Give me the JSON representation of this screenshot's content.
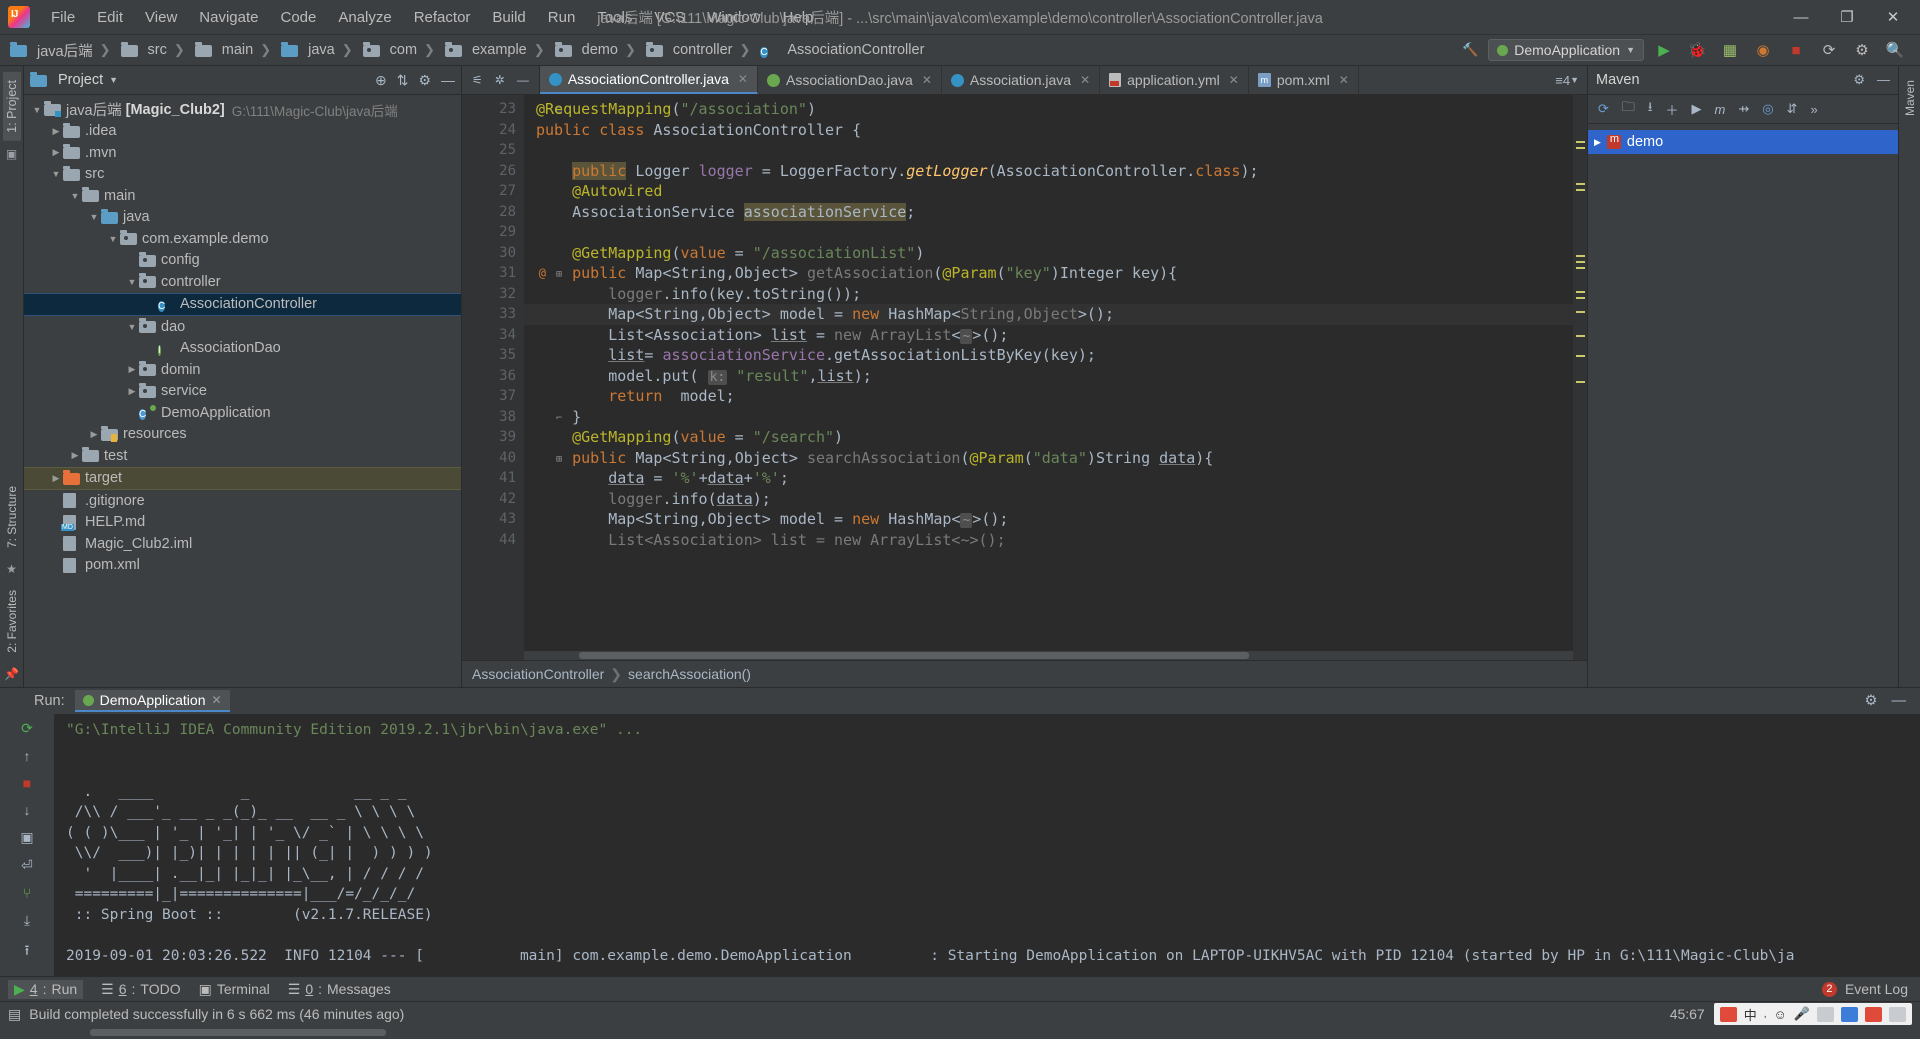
{
  "window": {
    "title": "java后端 [G:\\111\\Magic-Club\\java后端] - ...\\src\\main\\java\\com\\example\\demo\\controller\\AssociationController.java",
    "minimize": "—",
    "maximize": "❐",
    "close": "✕"
  },
  "menu": [
    "File",
    "Edit",
    "View",
    "Navigate",
    "Code",
    "Analyze",
    "Refactor",
    "Build",
    "Run",
    "Tools",
    "VCS",
    "Window",
    "Help"
  ],
  "breadcrumb": [
    "java后端",
    "src",
    "main",
    "java",
    "com",
    "example",
    "demo",
    "controller",
    "AssociationController"
  ],
  "navbar_right": {
    "run_config": "DemoApplication",
    "icons": [
      "hammer-icon",
      "run-icon",
      "debug-icon",
      "coverage-icon",
      "profile-icon",
      "stop-icon",
      "update-icon",
      "settings-icon",
      "search-icon"
    ]
  },
  "project_panel": {
    "title": "Project",
    "left_tabs": [
      "1: Project"
    ],
    "tree": [
      {
        "depth": 0,
        "arrow": "▼",
        "icon": "module-folder",
        "label": "java后端",
        "bold_label": "[Magic_Club2]",
        "path": "G:\\111\\Magic-Club\\java后端",
        "state": "normal"
      },
      {
        "depth": 1,
        "arrow": "▶",
        "icon": "folder",
        "label": ".idea",
        "state": "normal"
      },
      {
        "depth": 1,
        "arrow": "▶",
        "icon": "folder",
        "label": ".mvn",
        "state": "normal"
      },
      {
        "depth": 1,
        "arrow": "▼",
        "icon": "folder",
        "label": "src",
        "state": "normal"
      },
      {
        "depth": 2,
        "arrow": "▼",
        "icon": "folder",
        "label": "main",
        "state": "normal"
      },
      {
        "depth": 3,
        "arrow": "▼",
        "icon": "folder-blue",
        "label": "java",
        "state": "normal"
      },
      {
        "depth": 4,
        "arrow": "▼",
        "icon": "package",
        "label": "com.example.demo",
        "state": "normal"
      },
      {
        "depth": 5,
        "arrow": "",
        "icon": "package",
        "label": "config",
        "state": "normal"
      },
      {
        "depth": 5,
        "arrow": "▼",
        "icon": "package",
        "label": "controller",
        "state": "normal"
      },
      {
        "depth": 6,
        "arrow": "",
        "icon": "class",
        "label": "AssociationController",
        "state": "selected"
      },
      {
        "depth": 5,
        "arrow": "▼",
        "icon": "package",
        "label": "dao",
        "state": "normal"
      },
      {
        "depth": 6,
        "arrow": "",
        "icon": "interface",
        "label": "AssociationDao",
        "state": "normal"
      },
      {
        "depth": 5,
        "arrow": "▶",
        "icon": "package",
        "label": "domin",
        "state": "normal"
      },
      {
        "depth": 5,
        "arrow": "▶",
        "icon": "package",
        "label": "service",
        "state": "normal"
      },
      {
        "depth": 5,
        "arrow": "",
        "icon": "spring-class",
        "label": "DemoApplication",
        "state": "normal"
      },
      {
        "depth": 3,
        "arrow": "▶",
        "icon": "resources-folder",
        "label": "resources",
        "state": "normal"
      },
      {
        "depth": 2,
        "arrow": "▶",
        "icon": "folder",
        "label": "test",
        "state": "normal"
      },
      {
        "depth": 1,
        "arrow": "▶",
        "icon": "folder-orange",
        "label": "target",
        "state": "highlight"
      },
      {
        "depth": 1,
        "arrow": "",
        "icon": "file",
        "label": ".gitignore",
        "state": "normal"
      },
      {
        "depth": 1,
        "arrow": "",
        "icon": "file-md",
        "label": "HELP.md",
        "state": "normal"
      },
      {
        "depth": 1,
        "arrow": "",
        "icon": "file",
        "label": "Magic_Club2.iml",
        "state": "normal"
      },
      {
        "depth": 1,
        "arrow": "",
        "icon": "file",
        "label": "pom.xml",
        "state": "normal"
      }
    ]
  },
  "editor": {
    "tabs": [
      {
        "label": "AssociationController.java",
        "icon": "class-icon",
        "active": true
      },
      {
        "label": "AssociationDao.java",
        "icon": "interface-icon",
        "active": false
      },
      {
        "label": "Association.java",
        "icon": "class-icon",
        "active": false
      },
      {
        "label": "application.yml",
        "icon": "yaml-icon",
        "active": false
      },
      {
        "label": "pom.xml",
        "icon": "maven-icon",
        "active": false
      }
    ],
    "tab_overflow": "4",
    "first_line_number": 23,
    "lines": [
      {
        "n": 23,
        "html": "<span class=\"ann\">@RequestMapping</span>(<span class=\"str\">\"/association\"</span>)",
        "indent": 0,
        "fold": "minus"
      },
      {
        "n": 24,
        "html": "<span class=\"kw\">public class</span> <span class=\"typ\">AssociationController</span> {",
        "indent": 0
      },
      {
        "n": 25,
        "html": "",
        "indent": 0
      },
      {
        "n": 26,
        "html": "    <span class=\"kw hl\">public</span> <span class=\"typ\">Logger</span> <span class=\"fld\">logger</span> = <span class=\"typ\">LoggerFactory</span>.<span class=\"ital\">getLogger</span>(<span class=\"typ\">AssociationController</span>.<span class=\"kw\">class</span>);",
        "indent": 1
      },
      {
        "n": 27,
        "html": "    <span class=\"ann\">@Autowired</span>",
        "indent": 1
      },
      {
        "n": 28,
        "html": "    <span class=\"typ\">AssociationService</span> <span class=\"hl\">associationService</span>;",
        "indent": 1
      },
      {
        "n": 29,
        "html": "",
        "indent": 1
      },
      {
        "n": 30,
        "html": "    <span class=\"ann\">@GetMapping</span>(<span class=\"kw\">value</span> = <span class=\"str\">\"/associationList\"</span>)",
        "indent": 1
      },
      {
        "n": 31,
        "html": "    <span class=\"kw\">public</span> <span class=\"typ\">Map</span>&lt;<span class=\"typ\">String</span>,<span class=\"typ\">Object</span>&gt; <span class=\"dimtype\">getAssociation</span>(<span class=\"ann\">@Param</span>(<span class=\"str\">\"key\"</span>)<span class=\"typ\">Integer</span> key){",
        "indent": 1,
        "gutter_mark": "@",
        "fold": "plus"
      },
      {
        "n": 32,
        "html": "        <span class=\"dimtype\">logger</span>.info(key.toString());",
        "indent": 2
      },
      {
        "n": 33,
        "html": "        <span class=\"typ\">Map</span>&lt;<span class=\"typ\">String</span>,<span class=\"typ\">Object</span>&gt; model = <span class=\"kw\">new</span> <span class=\"typ\">HashMap</span>&lt;<span class=\"dimtype\">String,Object</span>&gt;();",
        "indent": 2,
        "current": true
      },
      {
        "n": 34,
        "html": "        <span class=\"typ\">List</span>&lt;<span class=\"typ\">Association</span>&gt; <span class=\"undl\">list</span> = <span class=\"dimtype\">new ArrayList</span>&lt;<span class=\"hintk\">~</span>&gt;();",
        "indent": 2
      },
      {
        "n": 35,
        "html": "        <span class=\"undl\">list</span>= <span class=\"fld\">associationService</span>.getAssociationListByKey(key);",
        "indent": 2
      },
      {
        "n": 36,
        "html": "        model.put( <span class=\"hintk\">k:</span> <span class=\"str\">\"result\"</span>,<span class=\"undl\">list</span>);",
        "indent": 2
      },
      {
        "n": 37,
        "html": "        <span class=\"kw\">return</span>  model;",
        "indent": 2
      },
      {
        "n": 38,
        "html": "    }",
        "indent": 1,
        "fold": "end"
      },
      {
        "n": 39,
        "html": "    <span class=\"ann\">@GetMapping</span>(<span class=\"kw\">value</span> = <span class=\"str\">\"/search\"</span>)",
        "indent": 1
      },
      {
        "n": 40,
        "html": "    <span class=\"kw\">public</span> <span class=\"typ\">Map</span>&lt;<span class=\"typ\">String</span>,<span class=\"typ\">Object</span>&gt; <span class=\"dimtype\">searchAssociation</span>(<span class=\"ann\">@Param</span>(<span class=\"str\">\"data\"</span>)<span class=\"typ\">String</span> <span class=\"undl\">data</span>){",
        "indent": 1,
        "fold": "plus"
      },
      {
        "n": 41,
        "html": "        <span class=\"undl\">data</span> = <span class=\"str\">'%'</span>+<span class=\"undl\">data</span>+<span class=\"str\">'%'</span>;",
        "indent": 2
      },
      {
        "n": 42,
        "html": "        <span class=\"dimtype\">logger</span>.info(<span class=\"undl\">data</span>);",
        "indent": 2
      },
      {
        "n": 43,
        "html": "        <span class=\"typ\">Map</span>&lt;<span class=\"typ\">String</span>,<span class=\"typ\">Object</span>&gt; model = <span class=\"kw\">new</span> <span class=\"typ\">HashMap</span>&lt;<span class=\"hintk\">~</span>&gt;();",
        "indent": 2
      },
      {
        "n": 44,
        "html": "        <span class=\"dimtype\">List&lt;Association&gt; list = new ArrayList&lt;~&gt;();</span>",
        "indent": 2
      }
    ],
    "status_breadcrumb": [
      "AssociationController",
      "searchAssociation()"
    ]
  },
  "maven_panel": {
    "title": "Maven",
    "side_label": "Maven",
    "toolbar_icons": [
      "refresh-icon",
      "add-folder-icon",
      "download-icon",
      "plus-icon",
      "run-icon",
      "m-icon",
      "skip-tests-icon",
      "settings-icon",
      "collapse-icon",
      "chevron-right-icon"
    ],
    "tree": [
      {
        "arrow": "▶",
        "label": "demo",
        "icon": "maven-project-icon"
      }
    ]
  },
  "left_strip": {
    "tabs": [
      "1: Project"
    ],
    "icons": [
      "structure-icon",
      "favorites-icon",
      "star-icon",
      "camera-icon",
      "database-icon"
    ]
  },
  "run_panel": {
    "label": "Run:",
    "tab": "DemoApplication",
    "close": "✕",
    "console": [
      "\"G:\\IntelliJ IDEA Community Edition 2019.2.1\\jbr\\bin\\java.exe\" ...",
      "",
      "",
      "  .   ____          _            __ _ _",
      " /\\\\ / ___'_ __ _ _(_)_ __  __ _ \\ \\ \\ \\",
      "( ( )\\___ | '_ | '_| | '_ \\/ _` | \\ \\ \\ \\",
      " \\\\/  ___)| |_)| | | | | || (_| |  ) ) ) )",
      "  '  |____| .__|_| |_|_| |_\\__, | / / / /",
      " =========|_|==============|___/=/_/_/_/",
      " :: Spring Boot ::        (v2.1.7.RELEASE)",
      "",
      "2019-09-01 20:03:26.522  INFO 12104 --- [           main] com.example.demo.DemoApplication         : Starting DemoApplication on LAPTOP-UIKHV5AC with PID 12104 (started by HP in G:\\111\\Magic-Club\\ja"
    ],
    "side_icons": [
      "rerun-icon",
      "up-icon",
      "stop-icon",
      "down-icon",
      "camera-icon",
      "wrap-icon",
      "print-icon",
      "trash-icon",
      "filter-icon",
      "scroll-icon"
    ]
  },
  "status_tabs": [
    {
      "num": "4",
      "label": "Run",
      "icon": "run-icon",
      "active": true
    },
    {
      "num": "6",
      "label": "TODO",
      "icon": "todo-icon",
      "active": false
    },
    {
      "num": "",
      "label": "Terminal",
      "icon": "terminal-icon",
      "active": false
    },
    {
      "num": "0",
      "label": "Messages",
      "icon": "messages-icon",
      "active": false
    }
  ],
  "status_right": {
    "event_log": "Event Log",
    "badge": "2"
  },
  "status_bar": {
    "message": "Build completed successfully in 6 s 662 ms (46 minutes ago)",
    "caret": "45:67",
    "tray": [
      "ime-icon",
      "cn-label",
      "keyboard-icon",
      "smiley-icon",
      "mic-icon",
      "tool-icon",
      "net-icon",
      "shield-icon",
      "lock-icon"
    ],
    "cn_label": "中"
  }
}
